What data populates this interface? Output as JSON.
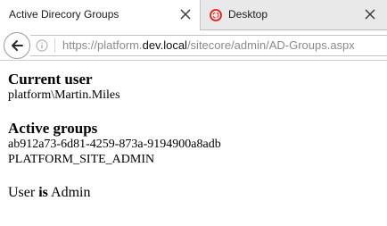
{
  "tabs": [
    {
      "title": "Active Direcory Groups",
      "active": true
    },
    {
      "title": "Desktop",
      "active": false
    }
  ],
  "address_bar": {
    "scheme": "https://platform.",
    "host": "dev.local",
    "path": "/sitecore/admin/AD-Groups.aspx"
  },
  "page": {
    "current_user_heading": "Current user",
    "current_user_value": "platform\\Martin.Miles",
    "active_groups_heading": "Active groups",
    "groups": [
      "ab912a73-6d81-4259-873a-9194900a8adb",
      "PLATFORM_SITE_ADMIN"
    ],
    "summary_prefix": "User ",
    "summary_bold": "is",
    "summary_suffix": " Admin"
  },
  "colors": {
    "tab_active_bg": "#ffffff",
    "tab_inactive_bg": "#e9e9e9",
    "favicon_red": "#e0201b"
  },
  "icons": {
    "close": "close-icon",
    "back": "back-arrow-icon",
    "info": "info-icon",
    "favicon": "ring-favicon-icon"
  }
}
